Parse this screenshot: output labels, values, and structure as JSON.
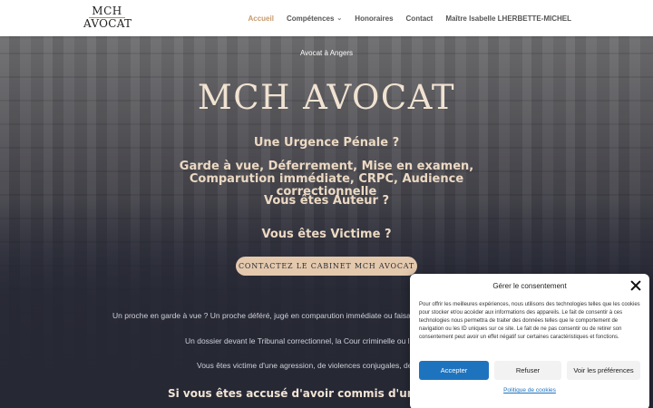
{
  "header": {
    "logo_line1": "MCH",
    "logo_line2": "AVOCAT",
    "nav": [
      {
        "label": "Accueil",
        "active": true
      },
      {
        "label": "Compétences",
        "has_dropdown": true
      },
      {
        "label": "Honoraires"
      },
      {
        "label": "Contact"
      },
      {
        "label": "Maître Isabelle LHERBETTE-MICHEL"
      }
    ]
  },
  "hero": {
    "subtitle": "Avocat à Angers",
    "title": "MCH AVOCAT",
    "tag1": "Une Urgence Pénale ?",
    "tag2": "Garde à vue, Déferrement, Mise en examen, Comparution immédiate, CRPC, Audience correctionnelle",
    "tag3": "Vous êtes Auteur  ?",
    "tag4": "Vous êtes Victime ?",
    "cta_label": "CONTACTEZ LE CABINET MCH AVOCAT"
  },
  "content": {
    "para1": "Un proche en garde à vue ? Un proche déféré, jugé en comparution immédiate ou faisan",
    "para2": "Un dossier devant le Tribunal correctionnel, la Cour criminelle ou la",
    "para3": "Vous êtes victime d'une agression, de violences conjugales, de h",
    "heading2": "Si vous êtes accusé d'avoir commis d'une infr"
  },
  "consent": {
    "title": "Gérer le consentement",
    "body": "Pour offrir les meilleures expériences, nous utilisons des technologies telles que les cookies pour stocker et/ou accéder aux informations des appareils. Le fait de consentir à ces technologies nous permettra de traiter des données telles que le comportement de navigation ou les ID uniques sur ce site. Le fait de ne pas consentir ou de retirer son consentement peut avoir un effet négatif sur certaines caractéristiques et fonctions.",
    "accept": "Accepter",
    "refuse": "Refuser",
    "preferences": "Voir les préférences",
    "policy_link": "Politique de cookies"
  },
  "colors": {
    "accent": "#c79a6b",
    "cta_bg": "#e4c9ad",
    "accept_bg": "#1e73be"
  }
}
